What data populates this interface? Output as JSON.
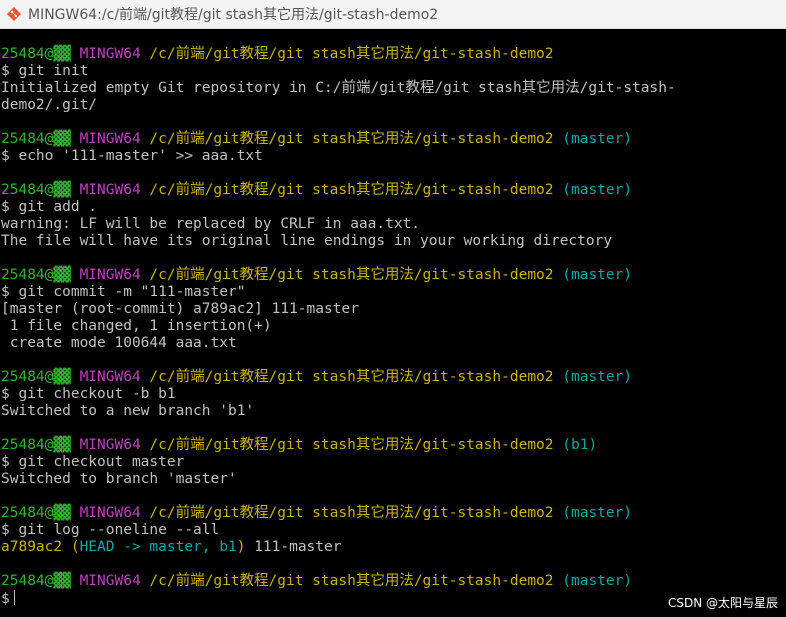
{
  "window": {
    "title": "MINGW64:/c/前端/git教程/git stash其它用法/git-stash-demo2",
    "icon": "git-bash-icon"
  },
  "colors": {
    "background": "#000000",
    "text": "#c0c0c0",
    "host": "#2cb52c",
    "env": "#c040c0",
    "path": "#c8b400",
    "branch": "#00a8a8"
  },
  "prompt": {
    "host": "25484@▓▓",
    "env": "MINGW64",
    "path": "/c/前端/git教程/git stash其它用法/git-stash-demo2"
  },
  "terminal": {
    "blocks": [
      {
        "branch": "",
        "command": "$ git init",
        "output": [
          "Initialized empty Git repository in C:/前端/git教程/git stash其它用法/git-stash-",
          "demo2/.git/"
        ]
      },
      {
        "branch": "(master)",
        "command": "$ echo '111-master' >> aaa.txt",
        "output": []
      },
      {
        "branch": "(master)",
        "command": "$ git add .",
        "output": [
          "warning: LF will be replaced by CRLF in aaa.txt.",
          "The file will have its original line endings in your working directory"
        ]
      },
      {
        "branch": "(master)",
        "command": "$ git commit -m \"111-master\"",
        "output": [
          "[master (root-commit) a789ac2] 111-master",
          " 1 file changed, 1 insertion(+)",
          " create mode 100644 aaa.txt"
        ]
      },
      {
        "branch": "(master)",
        "command": "$ git checkout -b b1",
        "output": [
          "Switched to a new branch 'b1'"
        ]
      },
      {
        "branch": "(b1)",
        "command": "$ git checkout master",
        "output": [
          "Switched to branch 'master'"
        ]
      },
      {
        "branch": "(master)",
        "command": "$ git log --oneline --all",
        "log": {
          "hash": "a789ac2",
          "open": " (",
          "refs": "HEAD -> master, b1",
          "close": ")",
          "message": " 111-master"
        }
      },
      {
        "branch": "(master)",
        "command": "$",
        "cursor": true
      }
    ]
  },
  "watermark": "CSDN @太阳与星辰"
}
